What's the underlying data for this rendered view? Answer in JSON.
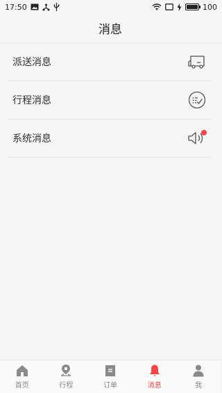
{
  "status_bar": {
    "time": "17:50",
    "battery_level": "100",
    "icons": [
      "image-icon",
      "usb-debug-icon",
      "usb-icon",
      "wifi-icon",
      "screen-icon",
      "charging-icon",
      "battery-icon"
    ]
  },
  "header": {
    "title": "消息"
  },
  "messages": {
    "items": [
      {
        "label": "派送消息",
        "icon": "delivery-truck-icon",
        "unread": false
      },
      {
        "label": "行程消息",
        "icon": "checklist-icon",
        "unread": false
      },
      {
        "label": "系统消息",
        "icon": "speaker-icon",
        "unread": true
      }
    ]
  },
  "tabbar": {
    "tabs": [
      {
        "label": "首页",
        "icon": "home-icon",
        "active": false
      },
      {
        "label": "行程",
        "icon": "location-pin-icon",
        "active": false
      },
      {
        "label": "订单",
        "icon": "order-icon",
        "active": false
      },
      {
        "label": "消息",
        "icon": "bell-icon",
        "active": true
      },
      {
        "label": "我",
        "icon": "user-icon",
        "active": false
      }
    ]
  },
  "colors": {
    "accent": "#f0474b",
    "background": "#f5f5f5",
    "tab_inactive": "#888888",
    "icon_gray": "#777777"
  }
}
